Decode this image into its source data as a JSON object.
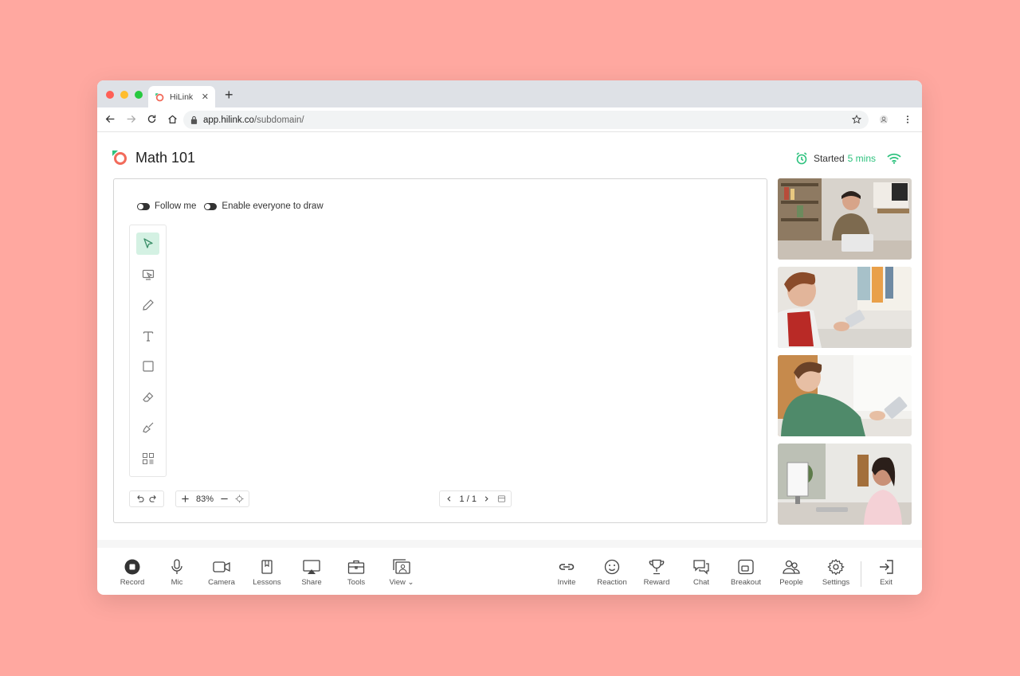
{
  "browser": {
    "tab_title": "HiLink",
    "new_tab_symbol": "+",
    "url_host": "app.hilink.co",
    "url_path": "/subdomain/",
    "traffic_lights": [
      "#ff5f56",
      "#ffbd2e",
      "#27c93f"
    ]
  },
  "header": {
    "title": "Math 101",
    "status_label": "Started",
    "status_time": "5 mins",
    "accent_color": "#2ec27e"
  },
  "whiteboard": {
    "toggle_follow_label": "Follow me",
    "toggle_draw_label": "Enable everyone to draw",
    "tools": [
      "pointer-icon",
      "screen-pointer-icon",
      "pencil-icon",
      "text-icon",
      "rectangle-icon",
      "eraser-icon",
      "clear-icon",
      "more-tools-icon"
    ],
    "zoom_level": "83%",
    "page_indicator": "1 / 1"
  },
  "participants": [
    {
      "name": "participant-1"
    },
    {
      "name": "participant-2"
    },
    {
      "name": "participant-3"
    },
    {
      "name": "participant-4"
    }
  ],
  "bottombar": {
    "left": [
      {
        "label": "Record",
        "icon": "record-icon"
      },
      {
        "label": "Mic",
        "icon": "mic-icon"
      },
      {
        "label": "Camera",
        "icon": "camera-icon"
      },
      {
        "label": "Lessons",
        "icon": "book-icon"
      },
      {
        "label": "Share",
        "icon": "screen-share-icon"
      },
      {
        "label": "Tools",
        "icon": "toolbox-icon"
      },
      {
        "label": "View",
        "icon": "view-icon"
      }
    ],
    "right": [
      {
        "label": "Invite",
        "icon": "link-icon"
      },
      {
        "label": "Reaction",
        "icon": "smile-icon"
      },
      {
        "label": "Reward",
        "icon": "trophy-icon"
      },
      {
        "label": "Chat",
        "icon": "chat-icon"
      },
      {
        "label": "Breakout",
        "icon": "breakout-icon"
      },
      {
        "label": "People",
        "icon": "people-icon"
      },
      {
        "label": "Settings",
        "icon": "gear-icon"
      },
      {
        "label": "Exit",
        "icon": "exit-icon"
      }
    ]
  }
}
